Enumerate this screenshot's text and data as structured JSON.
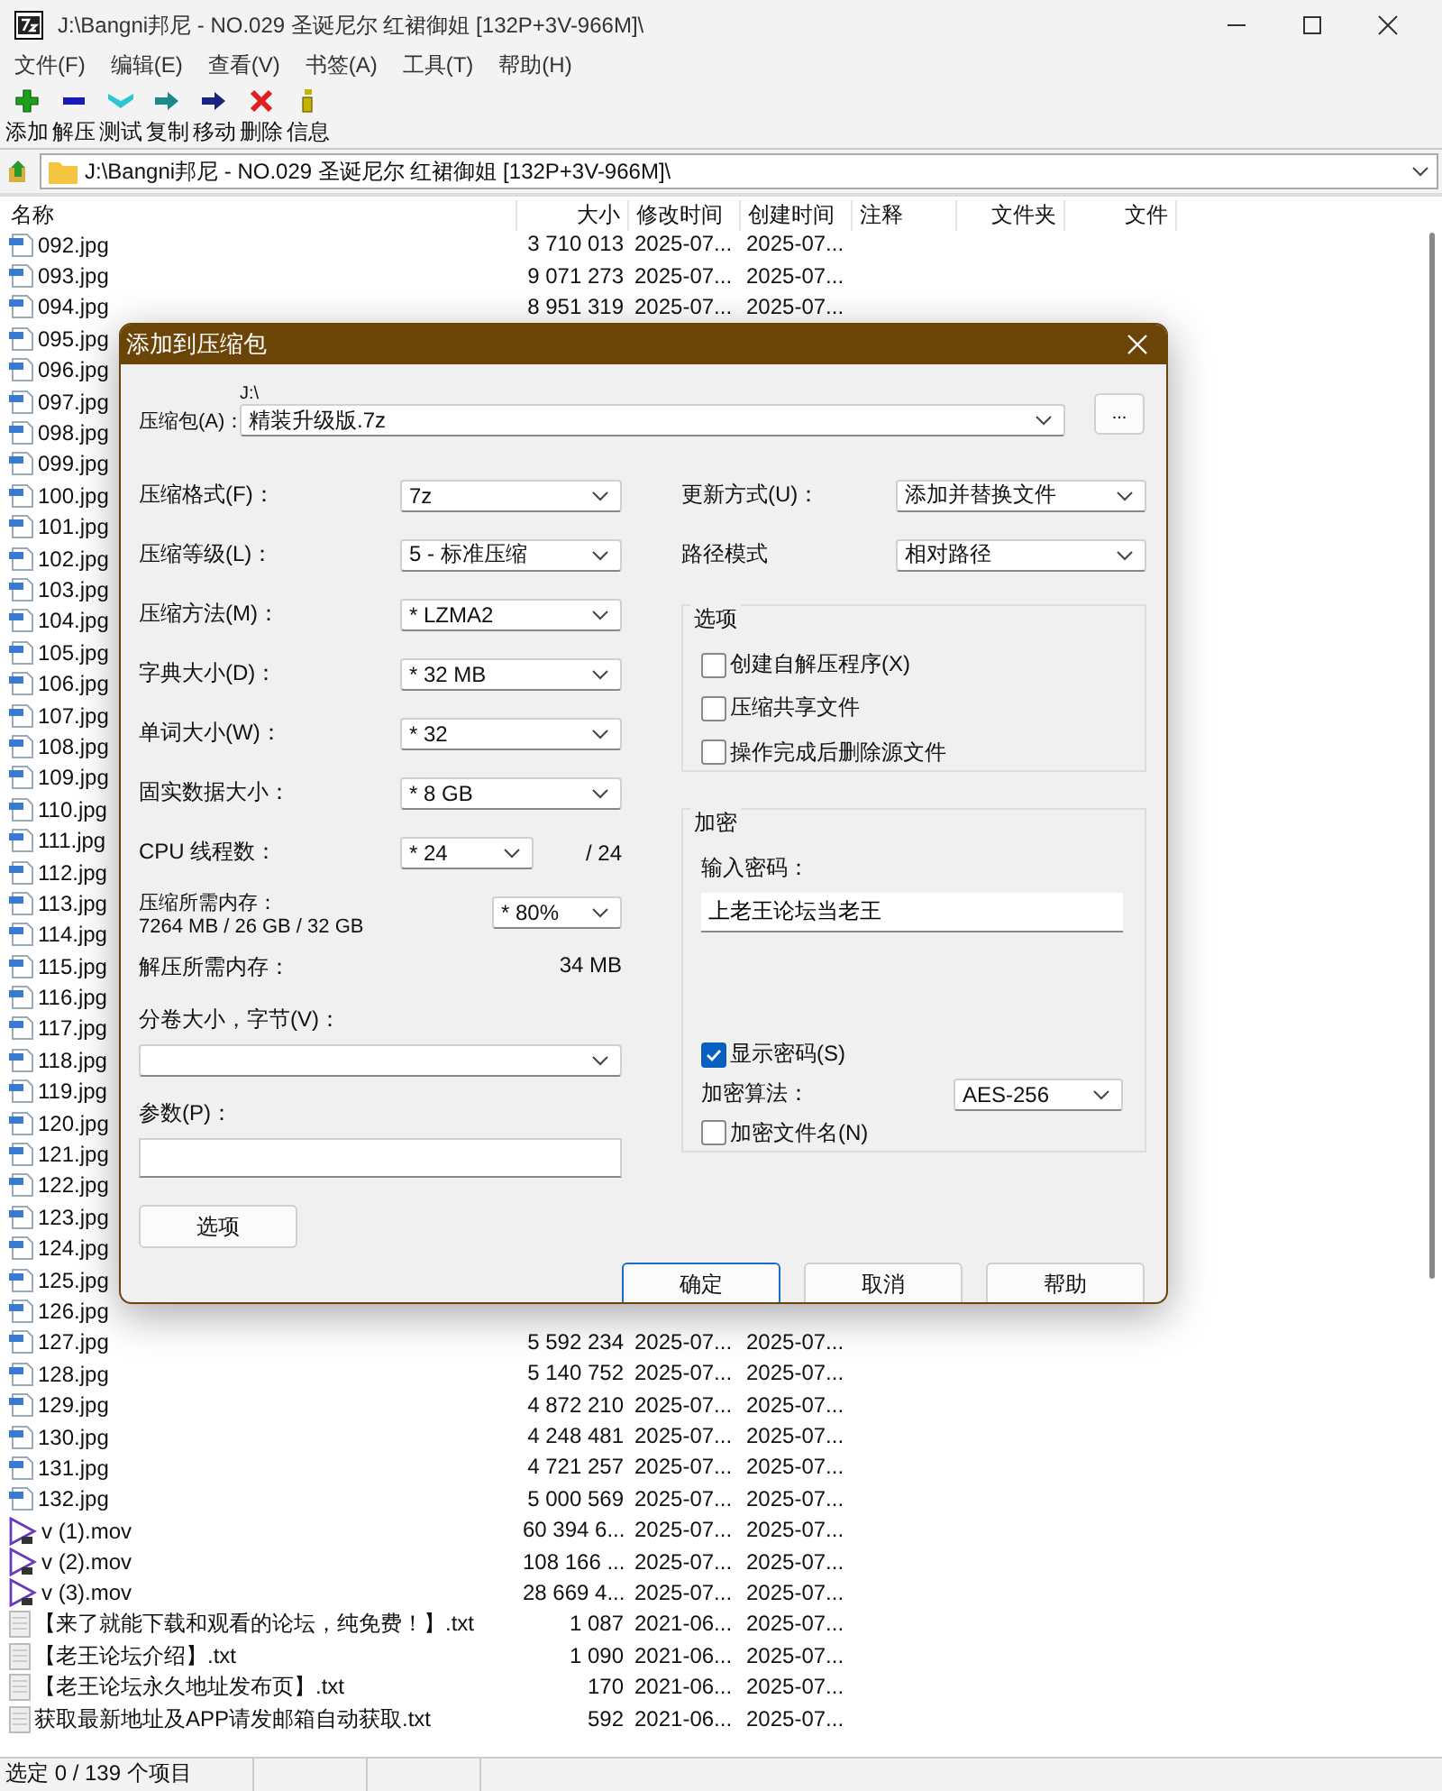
{
  "window": {
    "title": "J:\\Bangni邦尼 - NO.029 圣诞尼尔 红裙御姐 [132P+3V-966M]\\"
  },
  "menu": [
    "文件(F)",
    "编辑(E)",
    "查看(V)",
    "书签(A)",
    "工具(T)",
    "帮助(H)"
  ],
  "toolbar": [
    {
      "label": "添加",
      "kind": "add"
    },
    {
      "label": "解压",
      "kind": "extract"
    },
    {
      "label": "测试",
      "kind": "test"
    },
    {
      "label": "复制",
      "kind": "copy"
    },
    {
      "label": "移动",
      "kind": "move"
    },
    {
      "label": "删除",
      "kind": "delete"
    },
    {
      "label": "信息",
      "kind": "info"
    }
  ],
  "address_bar": {
    "path": "J:\\Bangni邦尼 - NO.029 圣诞尼尔 红裙御姐 [132P+3V-966M]\\"
  },
  "file_list": {
    "columns": [
      "名称",
      "大小",
      "修改时间",
      "创建时间",
      "注释",
      "文件夹",
      "文件"
    ],
    "rows": [
      {
        "name": "092.jpg",
        "kind": "image",
        "size": "3 710 013",
        "modified": "2025-07...",
        "created": "2025-07..."
      },
      {
        "name": "093.jpg",
        "kind": "image",
        "size": "9 071 273",
        "modified": "2025-07...",
        "created": "2025-07..."
      },
      {
        "name": "094.jpg",
        "kind": "image",
        "size": "8 951 319",
        "modified": "2025-07...",
        "created": "2025-07..."
      },
      {
        "name": "095.jpg",
        "kind": "image"
      },
      {
        "name": "096.jpg",
        "kind": "image"
      },
      {
        "name": "097.jpg",
        "kind": "image"
      },
      {
        "name": "098.jpg",
        "kind": "image"
      },
      {
        "name": "099.jpg",
        "kind": "image"
      },
      {
        "name": "100.jpg",
        "kind": "image"
      },
      {
        "name": "101.jpg",
        "kind": "image"
      },
      {
        "name": "102.jpg",
        "kind": "image"
      },
      {
        "name": "103.jpg",
        "kind": "image"
      },
      {
        "name": "104.jpg",
        "kind": "image"
      },
      {
        "name": "105.jpg",
        "kind": "image"
      },
      {
        "name": "106.jpg",
        "kind": "image"
      },
      {
        "name": "107.jpg",
        "kind": "image"
      },
      {
        "name": "108.jpg",
        "kind": "image"
      },
      {
        "name": "109.jpg",
        "kind": "image"
      },
      {
        "name": "110.jpg",
        "kind": "image"
      },
      {
        "name": "111.jpg",
        "kind": "image"
      },
      {
        "name": "112.jpg",
        "kind": "image"
      },
      {
        "name": "113.jpg",
        "kind": "image"
      },
      {
        "name": "114.jpg",
        "kind": "image"
      },
      {
        "name": "115.jpg",
        "kind": "image"
      },
      {
        "name": "116.jpg",
        "kind": "image"
      },
      {
        "name": "117.jpg",
        "kind": "image"
      },
      {
        "name": "118.jpg",
        "kind": "image"
      },
      {
        "name": "119.jpg",
        "kind": "image"
      },
      {
        "name": "120.jpg",
        "kind": "image"
      },
      {
        "name": "121.jpg",
        "kind": "image"
      },
      {
        "name": "122.jpg",
        "kind": "image"
      },
      {
        "name": "123.jpg",
        "kind": "image"
      },
      {
        "name": "124.jpg",
        "kind": "image"
      },
      {
        "name": "125.jpg",
        "kind": "image"
      },
      {
        "name": "126.jpg",
        "kind": "image"
      },
      {
        "name": "127.jpg",
        "kind": "image",
        "size": "5 592 234",
        "modified": "2025-07...",
        "created": "2025-07..."
      },
      {
        "name": "128.jpg",
        "kind": "image",
        "size": "5 140 752",
        "modified": "2025-07...",
        "created": "2025-07..."
      },
      {
        "name": "129.jpg",
        "kind": "image",
        "size": "4 872 210",
        "modified": "2025-07...",
        "created": "2025-07..."
      },
      {
        "name": "130.jpg",
        "kind": "image",
        "size": "4 248 481",
        "modified": "2025-07...",
        "created": "2025-07..."
      },
      {
        "name": "131.jpg",
        "kind": "image",
        "size": "4 721 257",
        "modified": "2025-07...",
        "created": "2025-07..."
      },
      {
        "name": "132.jpg",
        "kind": "image",
        "size": "5 000 569",
        "modified": "2025-07...",
        "created": "2025-07..."
      },
      {
        "name": "v (1).mov",
        "kind": "video",
        "size": "60 394 6...",
        "modified": "2025-07...",
        "created": "2025-07..."
      },
      {
        "name": "v (2).mov",
        "kind": "video",
        "size": "108 166 ...",
        "modified": "2025-07...",
        "created": "2025-07..."
      },
      {
        "name": "v (3).mov",
        "kind": "video",
        "size": "28 669 4...",
        "modified": "2025-07...",
        "created": "2025-07..."
      },
      {
        "name": "【来了就能下载和观看的论坛，纯免费！】.txt",
        "kind": "text",
        "size": "1 087",
        "modified": "2021-06...",
        "created": "2025-07..."
      },
      {
        "name": "【老王论坛介绍】.txt",
        "kind": "text",
        "size": "1 090",
        "modified": "2021-06...",
        "created": "2025-07..."
      },
      {
        "name": "【老王论坛永久地址发布页】.txt",
        "kind": "text",
        "size": "170",
        "modified": "2021-06...",
        "created": "2025-07..."
      },
      {
        "name": "获取最新地址及APP请发邮箱自动获取.txt",
        "kind": "text",
        "size": "592",
        "modified": "2021-06...",
        "created": "2025-07..."
      }
    ]
  },
  "status_bar": {
    "text": "选定 0 / 139 个项目"
  },
  "dialog": {
    "title": "添加到压缩包",
    "archive": {
      "label": "压缩包(A)：",
      "folder": "J:\\",
      "value": "精装升级版.7z",
      "browse": "..."
    },
    "settings": [
      {
        "label": "压缩格式(F)：",
        "value": "7z"
      },
      {
        "label": "压缩等级(L)：",
        "value": "5 - 标准压缩"
      },
      {
        "label": "压缩方法(M)：",
        "value": "*  LZMA2"
      },
      {
        "label": "字典大小(D)：",
        "value": "*  32 MB"
      },
      {
        "label": "单词大小(W)：",
        "value": "*  32"
      },
      {
        "label": "固实数据大小：",
        "value": "*  8 GB"
      }
    ],
    "threads": {
      "label": "CPU 线程数：",
      "value": "*  24",
      "max": "/ 24"
    },
    "memory": {
      "label": "压缩所需内存：",
      "detail": "7264 MB / 26 GB / 32 GB",
      "value": "*  80%"
    },
    "decompress": {
      "label": "解压所需内存：",
      "value": "34 MB"
    },
    "volume": {
      "label": "分卷大小，字节(V)："
    },
    "parameters": {
      "label": "参数(P)："
    },
    "options_button": "选项",
    "update_mode": {
      "label": "更新方式(U)：",
      "value": "添加并替换文件"
    },
    "path_mode": {
      "label": "路径模式",
      "value": "相对路径"
    },
    "options_group": {
      "title": "选项",
      "checkboxes": [
        {
          "label": "创建自解压程序(X)",
          "checked": false
        },
        {
          "label": "压缩共享文件",
          "checked": false
        },
        {
          "label": "操作完成后删除源文件",
          "checked": false
        }
      ]
    },
    "encryption": {
      "title": "加密",
      "password_label": "输入密码：",
      "password": "上老王论坛当老王",
      "show_password": {
        "label": "显示密码(S)",
        "checked": true
      },
      "method": {
        "label": "加密算法：",
        "value": "AES-256"
      },
      "encrypt_names": {
        "label": "加密文件名(N)",
        "checked": false
      }
    },
    "buttons": [
      {
        "label": "确定",
        "default": true
      },
      {
        "label": "取消",
        "default": false
      },
      {
        "label": "帮助",
        "default": false
      }
    ]
  }
}
